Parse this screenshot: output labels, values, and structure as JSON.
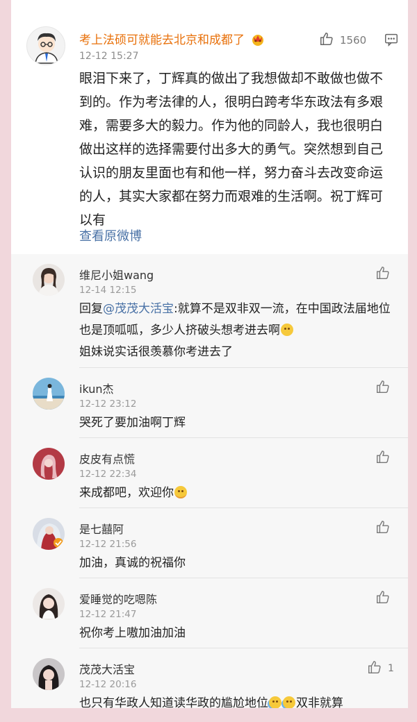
{
  "post": {
    "author": "考上法硕可就能去北京和成都了",
    "badge_icon": "vip-crown-icon",
    "time": "12-12 15:27",
    "likes": "1560",
    "text": "眼泪下来了，丁辉真的做出了我想做却不敢做也做不到的。作为考法律的人，很明白跨考华东政法有多艰难，需要多大的毅力。作为他的同龄人，我也很明白做出这样的选择需要付出多大的勇气。突然想到自己认识的朋友里面也有和他一样，努力奋斗去改变命运的人，其实大家都在努力而艰难的生活啊。祝丁辉可以有",
    "view_original": "查看原微博"
  },
  "replies": [
    {
      "name": "维尼小姐wang",
      "time": "12-14 12:15",
      "prefix": "回复",
      "mention": "@茂茂大活宝",
      "text": ":就算不是双非双一流，在中国政法届地位也是顶呱呱，多少人挤破头想考进去啊",
      "text2": "姐妹说实话很羡慕你考进去了",
      "likes": ""
    },
    {
      "name": "ikun杰",
      "time": "12-12 23:12",
      "text": "哭死了要加油啊丁辉",
      "likes": ""
    },
    {
      "name": "皮皮有点慌",
      "time": "12-12 22:34",
      "text": "来成都吧，欢迎你",
      "likes": ""
    },
    {
      "name": "是七囍阿",
      "time": "12-12 21:56",
      "text": "加油，真诚的祝福你",
      "likes": ""
    },
    {
      "name": "爱睡觉的吃嗯陈",
      "time": "12-12 21:47",
      "text": "祝你考上嗷加油加油",
      "likes": ""
    },
    {
      "name": "茂茂大活宝",
      "time": "12-12 20:16",
      "text": "也只有华政人知道读华政的尴尬地位",
      "text_tail": "双非就算",
      "likes": "1"
    }
  ],
  "colors": {
    "accent_name": "#e8700a",
    "link": "#4a72a6",
    "background": "#f1d7dc"
  }
}
